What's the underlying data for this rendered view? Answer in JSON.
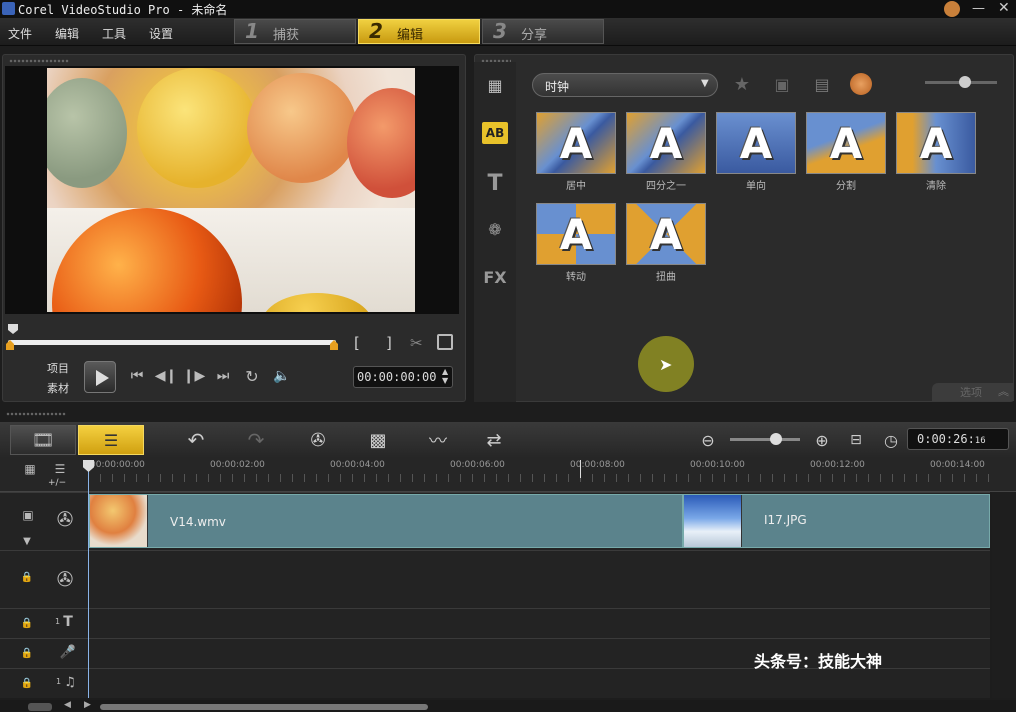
{
  "window": {
    "title": "Corel VideoStudio Pro - 未命名"
  },
  "menu": [
    "文件",
    "编辑",
    "工具",
    "设置"
  ],
  "steps": [
    {
      "num": "1",
      "label": "捕获"
    },
    {
      "num": "2",
      "label": "编辑"
    },
    {
      "num": "3",
      "label": "分享"
    }
  ],
  "player": {
    "mode_project": "项目",
    "mode_clip": "素材",
    "timecode": "00:00:00:00",
    "trim_start": "[",
    "trim_end": "]"
  },
  "library": {
    "category": "时钟",
    "transitions": [
      {
        "label": "居中"
      },
      {
        "label": "四分之一"
      },
      {
        "label": "单向"
      },
      {
        "label": "分割"
      },
      {
        "label": "清除"
      },
      {
        "label": "转动"
      },
      {
        "label": "扭曲"
      }
    ],
    "options_label": "选项"
  },
  "timeline": {
    "total_duration": "0:00:26:",
    "total_duration_frames": "16",
    "ruler": [
      "00:00:00:00",
      "00:00:02:00",
      "00:00:04:00",
      "00:00:06:00",
      "00:00:08:00",
      "00:00:10:00",
      "00:00:12:00",
      "00:00:14:00"
    ],
    "clips": [
      {
        "name": "V14.wmv"
      },
      {
        "name": "I17.JPG"
      }
    ],
    "title_track_num": "1",
    "music_track_num": "1",
    "add_tracks": "+/−"
  },
  "watermark": "头条号：技能大神",
  "colors": {
    "accent": "#e8c22a",
    "clip": "#5b838c",
    "bg": "#2b2b2b"
  }
}
